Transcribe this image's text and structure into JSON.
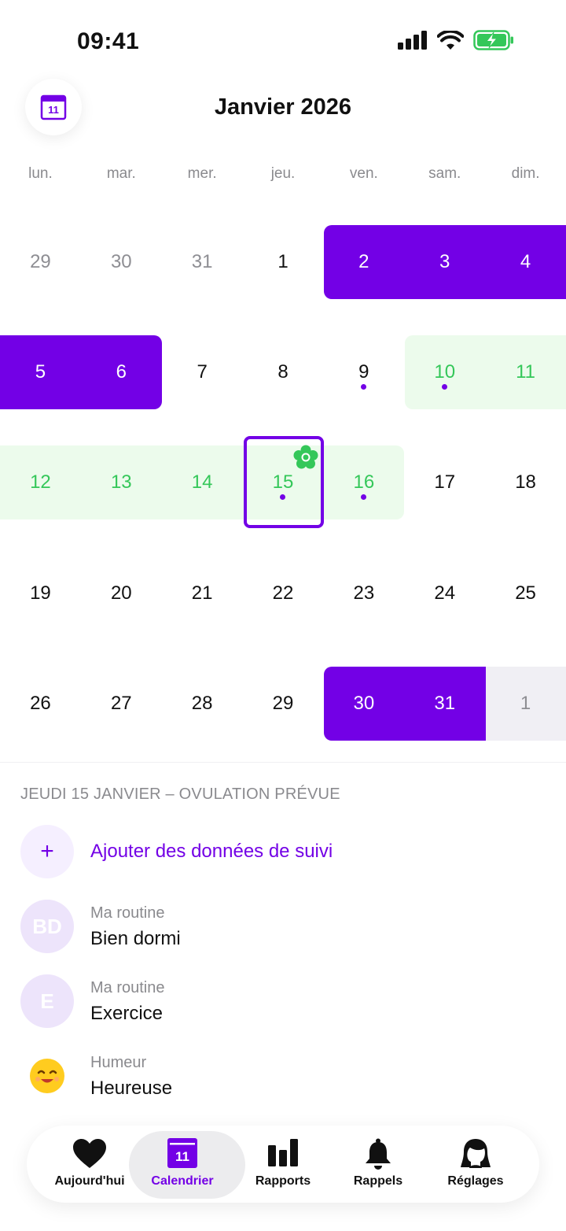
{
  "status_bar": {
    "time": "09:41"
  },
  "header": {
    "calendar_button_day": "11",
    "month_title": "Janvier 2026"
  },
  "weekdays": [
    "lun.",
    "mar.",
    "mer.",
    "jeu.",
    "ven.",
    "sam.",
    "dim."
  ],
  "calendar": {
    "weeks": [
      [
        "29",
        "30",
        "31",
        "1",
        "2",
        "3",
        "4"
      ],
      [
        "5",
        "6",
        "7",
        "8",
        "9",
        "10",
        "11"
      ],
      [
        "12",
        "13",
        "14",
        "15",
        "16",
        "17",
        "18"
      ],
      [
        "19",
        "20",
        "21",
        "22",
        "23",
        "24",
        "25"
      ],
      [
        "26",
        "27",
        "28",
        "29",
        "30",
        "31",
        "1"
      ]
    ],
    "selected_date": "15",
    "period_days": [
      "2",
      "3",
      "4",
      "5",
      "6",
      "30",
      "31"
    ],
    "fertile_days": [
      "10",
      "11",
      "12",
      "13",
      "14",
      "15",
      "16"
    ],
    "predicted_next_period_days": [
      "1"
    ],
    "tracked_dot_days": [
      "9",
      "10",
      "15",
      "16"
    ],
    "ovulation_day": "15",
    "colors": {
      "period": "#7300e6",
      "fertile_bg": "#ecfbec",
      "fertile_text": "#34c759",
      "predicted_bg": "#f0eff4"
    }
  },
  "details": {
    "section_title": "JEUDI 15 JANVIER – OVULATION PRÉVUE",
    "add_button": {
      "icon": "+",
      "label": "Ajouter des données de suivi"
    },
    "entries": [
      {
        "avatar": "BD",
        "category": "Ma routine",
        "value": "Bien dormi"
      },
      {
        "avatar": "E",
        "category": "Ma routine",
        "value": "Exercice"
      },
      {
        "avatar": "smiling-face-icon",
        "category": "Humeur",
        "value": "Heureuse"
      }
    ]
  },
  "tab_bar": {
    "tabs": [
      {
        "label": "Aujourd'hui",
        "icon": "heart-icon"
      },
      {
        "label": "Calendrier",
        "icon": "calendar-icon",
        "badge": "11",
        "active": true
      },
      {
        "label": "Rapports",
        "icon": "bar-chart-icon"
      },
      {
        "label": "Rappels",
        "icon": "bell-icon"
      },
      {
        "label": "Réglages",
        "icon": "profile-icon"
      }
    ]
  }
}
